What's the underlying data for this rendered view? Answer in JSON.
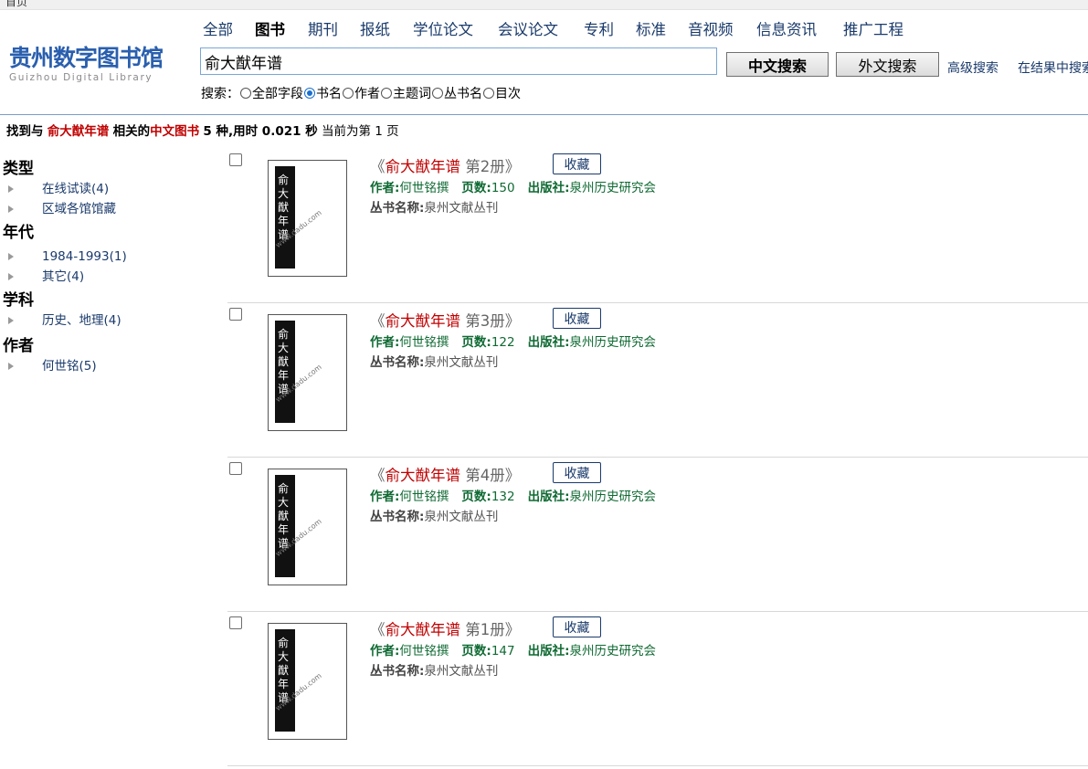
{
  "topbar": {
    "text": "首页"
  },
  "logo": {
    "cn": "贵州数字图书馆",
    "en": "Guizhou Digital Library"
  },
  "nav": [
    "全部",
    "图书",
    "期刊",
    "报纸",
    "学位论文",
    "会议论文",
    "专利",
    "标准",
    "音视频",
    "信息资讯",
    "推广工程"
  ],
  "nav_active": "图书",
  "search": {
    "value": "俞大猷年谱",
    "cn_button": "中文搜索",
    "foreign_button": "外文搜索",
    "advanced": "高级搜索",
    "within": "在结果中搜索",
    "options_label": "搜索：",
    "options": [
      "全部字段",
      "书名",
      "作者",
      "主题词",
      "丛书名",
      "目次"
    ],
    "selected_option": "书名"
  },
  "summary": {
    "prefix": "找到与",
    "keyword": "俞大猷年谱",
    "mid": "相关的",
    "category": "中文图书",
    "count_text": "5 种,用时 0.021 秒",
    "page_text": "当前为第 1 页"
  },
  "facets": [
    {
      "title": "类型",
      "items": [
        "在线试读(4)",
        "区域各馆馆藏"
      ]
    },
    {
      "title": "年代",
      "items": [
        "1984-1993(1)",
        "其它(4)"
      ]
    },
    {
      "title": "学科",
      "items": [
        "历史、地理(4)"
      ]
    },
    {
      "title": "作者",
      "items": [
        "何世铭(5)"
      ]
    }
  ],
  "results": [
    {
      "title": "俞大猷年谱",
      "volume": "第2册",
      "author": "何世铭撰",
      "pages": "150",
      "publisher": "泉州历史研究会",
      "series": "泉州文献丛刊"
    },
    {
      "title": "俞大猷年谱",
      "volume": "第3册",
      "author": "何世铭撰",
      "pages": "122",
      "publisher": "泉州历史研究会",
      "series": "泉州文献丛刊"
    },
    {
      "title": "俞大猷年谱",
      "volume": "第4册",
      "author": "何世铭撰",
      "pages": "132",
      "publisher": "泉州历史研究会",
      "series": "泉州文献丛刊"
    },
    {
      "title": "俞大猷年谱",
      "volume": "第1册",
      "author": "何世铭撰",
      "pages": "147",
      "publisher": "泉州历史研究会",
      "series": "泉州文献丛刊"
    }
  ],
  "labels": {
    "favorite": "收藏",
    "author": "作者:",
    "pages": "页数:",
    "publisher": "出版社:",
    "series": "丛书名称:",
    "book_open": "《",
    "book_close": "》"
  },
  "cover": {
    "inscription": "俞大猷年谱",
    "watermark": "www.dadu.com"
  },
  "colors": {
    "link": "#1a3a6b",
    "highlight": "#c00000",
    "meta": "#0f6a33",
    "logo": "#2a5fae"
  }
}
